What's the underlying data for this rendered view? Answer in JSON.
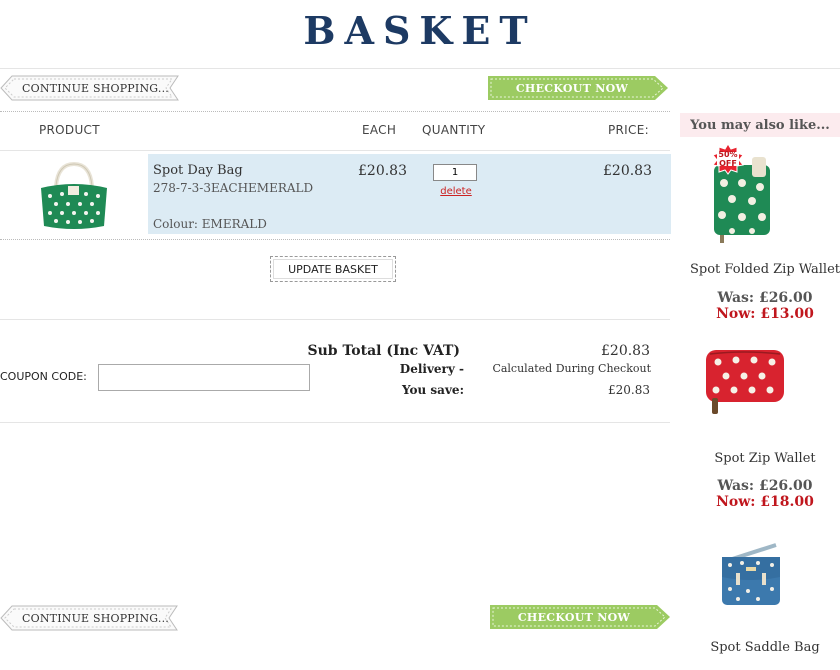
{
  "page": {
    "title": "BASKET"
  },
  "nav": {
    "continue_label": "CONTINUE SHOPPING...",
    "checkout_label": "CHECKOUT NOW"
  },
  "table": {
    "headers": {
      "product": "PRODUCT",
      "each": "EACH",
      "quantity": "QUANTITY",
      "price": "PRICE:"
    }
  },
  "item": {
    "name": "Spot Day Bag",
    "sku": "278-7-3-3EACHEMERALD",
    "colour": "Colour: EMERALD",
    "each": "£20.83",
    "quantity": "1",
    "delete_label": "delete",
    "price": "£20.83"
  },
  "actions": {
    "update_basket": "UPDATE BASKET"
  },
  "coupon": {
    "label": "COUPON CODE:",
    "value": ""
  },
  "totals": {
    "subtotal_label": "Sub Total (Inc VAT)",
    "subtotal_value": "£20.83",
    "delivery_label": "Delivery -",
    "delivery_value": "Calculated During Checkout",
    "save_label": "You save:",
    "save_value": "£20.83"
  },
  "sidebar": {
    "heading": "You may also like...",
    "products": [
      {
        "name": "Spot Folded Zip Wallet",
        "was": "Was: £26.00",
        "now": "Now: £13.00",
        "badge": "50% OFF"
      },
      {
        "name": "Spot Zip Wallet",
        "was": "Was: £26.00",
        "now": "Now: £18.00"
      },
      {
        "name": "Spot Saddle Bag"
      }
    ]
  },
  "colors": {
    "title": "#1d3a63",
    "checkout_green": "#9ccb62",
    "row_bg": "#dcebf4",
    "sale_red": "#c0161d",
    "emerald": "#1f8a55",
    "wallet_red": "#d8232f",
    "saddle_blue": "#3c79ad"
  }
}
